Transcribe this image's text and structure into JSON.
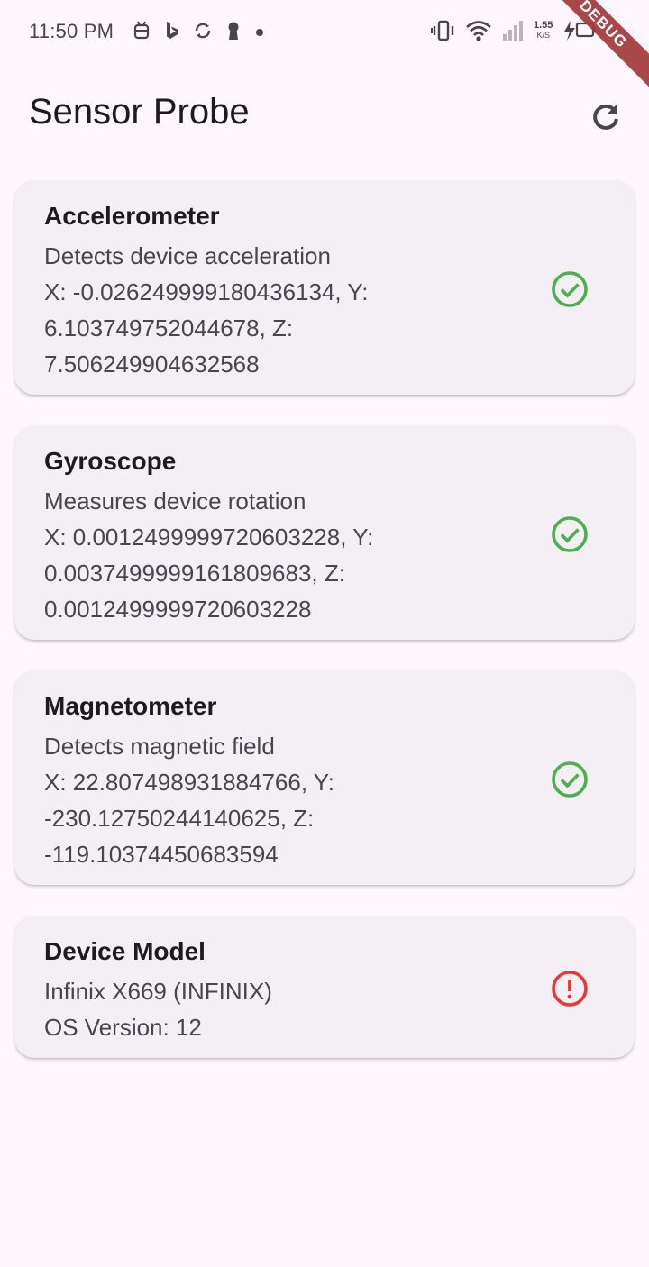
{
  "status_bar": {
    "time": "11:50 PM",
    "net_speed_value": "1.55",
    "net_speed_unit": "K/S"
  },
  "debug_banner": "DEBUG",
  "app_bar": {
    "title": "Sensor Probe",
    "refresh_icon": "refresh-icon"
  },
  "colors": {
    "ok": "#4caf50",
    "error": "#e53935",
    "background": "#fdf7fd",
    "card": "#f4eff4"
  },
  "cards": [
    {
      "title": "Accelerometer",
      "description": "Detects device acceleration",
      "value_lines": [
        "X: -0.026249999180436134, Y:",
        "6.103749752044678, Z:",
        "7.506249904632568"
      ],
      "status": "check-circle-icon"
    },
    {
      "title": "Gyroscope",
      "description": "Measures device rotation",
      "value_lines": [
        "X: 0.0012499999720603228, Y:",
        "0.0037499999161809683, Z:",
        "0.0012499999720603228"
      ],
      "status": "check-circle-icon"
    },
    {
      "title": "Magnetometer",
      "description": "Detects magnetic field",
      "value_lines": [
        "X: 22.807498931884766, Y:",
        "-230.12750244140625, Z:",
        "-119.10374450683594"
      ],
      "status": "check-circle-icon"
    },
    {
      "title": "Device Model",
      "description": "Infinix X669 (INFINIX)",
      "value_lines": [
        "OS Version: 12"
      ],
      "status": "error-circle-icon"
    }
  ]
}
